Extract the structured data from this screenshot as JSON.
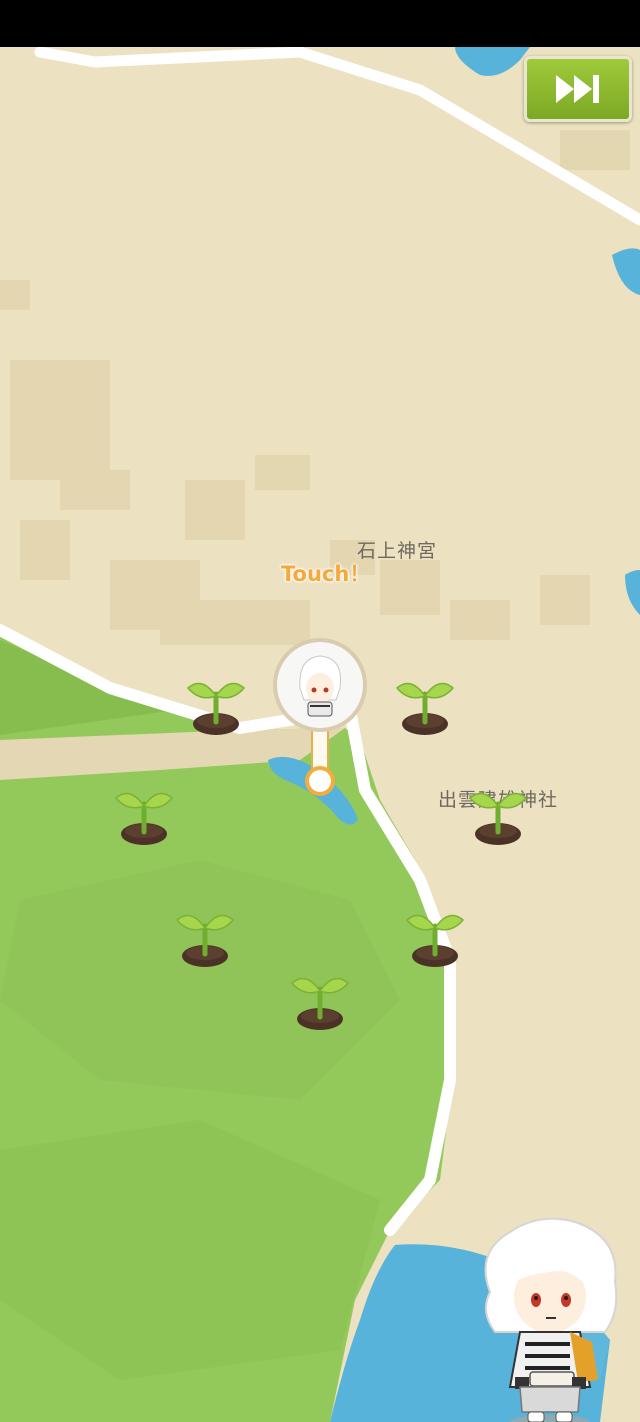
{
  "map": {
    "place_labels": [
      "石上神宮",
      "出雲建雄神社"
    ],
    "touch_prompt": "Touch！"
  },
  "colors": {
    "sand": "#ece1c1",
    "grass": "#93c85a",
    "water": "#57b3d9",
    "road": "#ffffff",
    "accent": "#f5a93a",
    "button": "#8db62e"
  },
  "icons": {
    "skip": "fast-forward-icon",
    "seedling": "seedling-icon",
    "pin": "character-map-pin-icon"
  },
  "sprouts": [
    "seedling-1",
    "seedling-2",
    "seedling-3",
    "seedling-4",
    "seedling-5",
    "seedling-6",
    "seedling-7",
    "seedling-8"
  ]
}
